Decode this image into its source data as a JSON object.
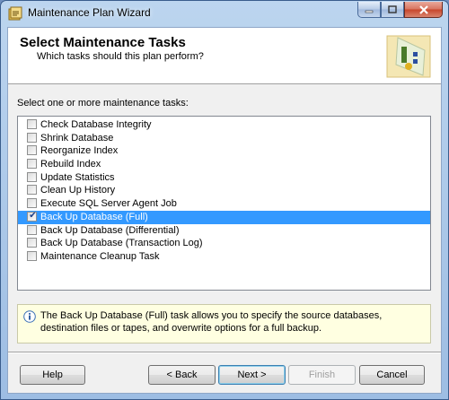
{
  "window": {
    "title": "Maintenance Plan Wizard"
  },
  "header": {
    "title": "Select Maintenance Tasks",
    "subtitle": "Which tasks should this plan perform?"
  },
  "prompt": "Select one or more maintenance tasks:",
  "tasks": [
    {
      "label": "Check Database Integrity",
      "checked": false,
      "selected": false
    },
    {
      "label": "Shrink Database",
      "checked": false,
      "selected": false
    },
    {
      "label": "Reorganize Index",
      "checked": false,
      "selected": false
    },
    {
      "label": "Rebuild Index",
      "checked": false,
      "selected": false
    },
    {
      "label": "Update Statistics",
      "checked": false,
      "selected": false
    },
    {
      "label": "Clean Up History",
      "checked": false,
      "selected": false
    },
    {
      "label": "Execute SQL Server Agent Job",
      "checked": false,
      "selected": false
    },
    {
      "label": "Back Up Database (Full)",
      "checked": true,
      "selected": true
    },
    {
      "label": "Back Up Database (Differential)",
      "checked": false,
      "selected": false
    },
    {
      "label": "Back Up Database (Transaction Log)",
      "checked": false,
      "selected": false
    },
    {
      "label": "Maintenance Cleanup Task",
      "checked": false,
      "selected": false
    }
  ],
  "info": {
    "icon": "info-icon",
    "text": "The Back Up Database (Full) task allows you to specify the source databases, destination files or tapes, and overwrite options for a full backup."
  },
  "buttons": {
    "help": "Help",
    "back": "< Back",
    "next": "Next >",
    "finish": "Finish",
    "cancel": "Cancel"
  },
  "colors": {
    "selection": "#3399ff",
    "info_background": "#ffffe1"
  }
}
